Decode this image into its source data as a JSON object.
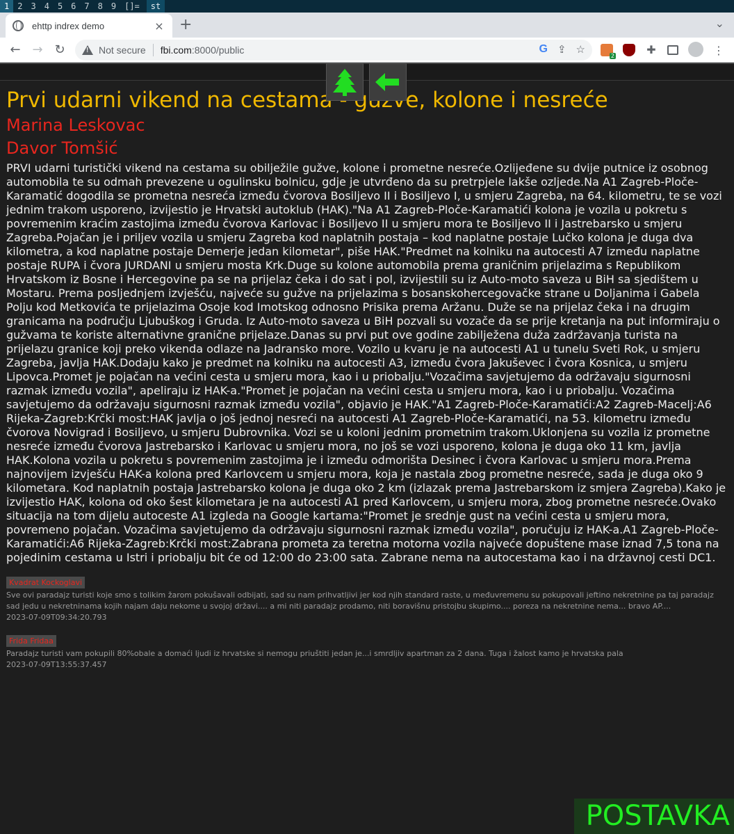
{
  "wm": {
    "workspaces": [
      "1",
      "2",
      "3",
      "4",
      "5",
      "6",
      "7",
      "8",
      "9"
    ],
    "layout": "[]=",
    "window_title": "st"
  },
  "browser": {
    "tab_title": "ehttp indrex demo",
    "tab_close": "×",
    "new_tab": "+",
    "tab_dropdown": "⌄",
    "back": "←",
    "forward": "→",
    "reload": "↻",
    "security_label": "Not secure",
    "url_host": "fbi.com",
    "url_rest": ":8000/public",
    "omnibox_icons": [
      "google-icon",
      "share-icon",
      "bookmark-star-icon"
    ],
    "extension_badge": "2"
  },
  "page": {
    "buttons": [
      "tree-icon",
      "back-arrow-icon"
    ],
    "headline": "Prvi udarni vikend na cestama - gužve, kolone i nesreće",
    "authors": [
      "Marina Leskovac",
      "Davor Tomšić"
    ],
    "body": "PRVI udarni turistički vikend na cestama su obilježile gužve, kolone i prometne nesreće.Ozlijeđene su dvije putnice iz osobnog automobila te su odmah prevezene u ogulinsku bolnicu, gdje je utvrđeno da su pretrpjele lakše ozljede.Na A1 Zagreb-Ploče-Karamatić dogodila se prometna nesreća između čvorova Bosiljevo II i Bosiljevo I, u smjeru Zagreba, na 64. kilometru, te se vozi jednim trakom usporeno, izvijestio je Hrvatski autoklub (HAK).\"Na A1 Zagreb-Ploče-Karamatići kolona je vozila u pokretu s povremenim kraćim zastojima između čvorova Karlovac i Bosiljevo II u smjeru mora te Bosiljevo II i Jastrebarsko u smjeru Zagreba.Pojačan je i priljev vozila u smjeru Zagreba kod naplatnih postaja – kod naplatne postaje Lučko kolona je duga dva kilometra, a kod naplatne postaje Demerje jedan kilometar\", piše HAK.\"Predmet na kolniku na autocesti A7 između naplatne postaje RUPA i čvora JURDANI u smjeru mosta Krk.Duge su kolone automobila prema graničnim prijelazima s Republikom Hrvatskom iz Bosne i Hercegovine pa se na prijelaz čeka i do sat i pol, izvijestili su iz Auto-moto saveza u BiH sa sjedištem u Mostaru. Prema posljednjem izvješću, najveće su gužve na prijelazima s bosanskohercegovačke strane u Doljanima i Gabela Polju kod Metkovića te prijelazima Osoje kod Imotskog odnosno Prisika prema Aržanu. Duže se na prijelaz čeka i na drugim granicama na području Ljubuškog i Gruda. Iz Auto-moto saveza u BiH pozvali su vozače da se prije kretanja na put informiraju o gužvama te koriste alternativne granične prijelaze.Danas su prvi put ove godine zabilježena duža zadržavanja turista na prijelazu granice koji preko vikenda odlaze na Jadransko more. Vozilo u kvaru je na autocesti A1 u tunelu Sveti Rok, u smjeru Zagreba, javlja HAK.Dodaju kako je predmet na kolniku na autocesti A3, između čvora Jakuševec i čvora Kosnica, u smjeru Lipovca.Promet je pojačan na većini cesta u smjeru mora, kao i u priobalju.\"Vozačima savjetujemo da održavaju sigurnosni razmak između vozila\", apeliraju iz HAK-a.\"Promet je pojačan na većini cesta u smjeru mora, kao i u priobalju. Vozačima savjetujemo da održavaju sigurnosni razmak između vozila\", objavio je HAK.\"A1 Zagreb-Ploče-Karamatići:A2 Zagreb-Macelj:A6 Rijeka-Zagreb:Krčki most:HAK javlja o još jednoj nesreći na autocesti A1 Zagreb-Ploče-Karamatići, na 53. kilometru između čvorova Novigrad i Bosiljevo, u smjeru Dubrovnika. Vozi se u koloni jednim prometnim trakom.Uklonjena su vozila iz prometne nesreće između čvorova Jastrebarsko i Karlovac u smjeru mora, no još se vozi usporeno, kolona je duga oko 11 km, javlja HAK.Kolona vozila u pokretu s povremenim zastojima je i između odmorišta Desinec i čvora Karlovac u smjeru mora.Prema najnovijem izvješću HAK-a kolona pred Karlovcem u smjeru mora, koja je nastala zbog prometne nesreće, sada je duga oko 9 kilometara. Kod naplatnih postaja Jastrebarsko kolona je duga oko 2 km (izlazak prema Jastrebarskom iz smjera Zagreba).Kako je izvijestio HAK, kolona od oko šest kilometara je na autocesti A1 pred Karlovcem, u smjeru mora, zbog prometne nesreće.Ovako situacija na tom dijelu autoceste A1 izgleda na Google kartama:\"Promet je srednje gust na većini cesta u smjeru mora, povremeno pojačan. Vozačima savjetujemo da održavaju sigurnosni razmak između vozila\", poručuju iz HAK-a.A1 Zagreb-Ploče-Karamatići:A6 Rijeka-Zagreb:Krčki most:Zabrana prometa za teretna motorna vozila najveće dopuštene mase iznad 7,5 tona na pojedinim cestama u Istri i priobalju bit će od 12:00 do 23:00 sata. Zabrane nema na autocestama kao i na državnoj cesti DC1.",
    "comments": [
      {
        "author": "Kvadrat Kockoglavi",
        "text": "Sve ovi paradajz turisti koje smo s tolikim žarom pokušavali odbijati, sad su nam prihvatljivi jer kod njih standard raste, u međuvremenu su pokupovali jeftino nekretnine pa taj paradajz sad jedu u nekretninama kojih najam daju nekome u svojoj državi.... a mi niti paradajz prodamo, niti boravišnu pristojbu skupimo.... poreza na nekretnine nema... bravo AP....",
        "date": "2023-07-09T09:34:20.793"
      },
      {
        "author": "Frida Fridaa",
        "text": "Paradajz turisti vam pokupili 80%obale a domaći ljudi iz hrvatske si nemogu priuštiti jedan je...i smrdljiv apartman za 2 dana. Tuga i žalost kamo je hrvatska pala",
        "date": "2023-07-09T13:55:37.457"
      }
    ],
    "post_button": "POSTAVKA"
  },
  "colors": {
    "headline": "#f0b800",
    "author": "#e8261e",
    "body": "#ececec",
    "post_button_text": "#22ee22",
    "tree": "#22dd22",
    "arrow": "#22dd22"
  }
}
